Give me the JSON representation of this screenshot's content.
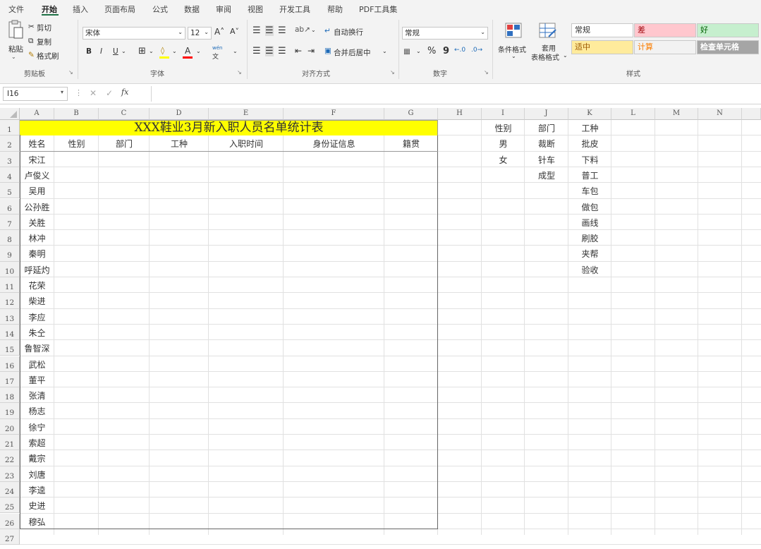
{
  "menu": {
    "tabs": [
      "文件",
      "开始",
      "插入",
      "页面布局",
      "公式",
      "数据",
      "审阅",
      "视图",
      "开发工具",
      "帮助",
      "PDF工具集"
    ],
    "active_tab": "开始"
  },
  "ribbon": {
    "clipboard": {
      "paste": "粘贴",
      "cut": "剪切",
      "copy": "复制",
      "format_painter": "格式刷",
      "label": "剪贴板"
    },
    "font": {
      "name": "宋体",
      "size": "12",
      "bold": "B",
      "italic": "I",
      "underline": "U",
      "label": "字体",
      "phonetic": "wén"
    },
    "alignment": {
      "wrap": "自动换行",
      "merge": "合并后居中",
      "label": "对齐方式"
    },
    "number": {
      "format": "常规",
      "percent": "%",
      "comma": "9",
      "label": "数字"
    },
    "styles": {
      "conditional": "条件格式",
      "table_format_1": "套用",
      "table_format_2": "表格格式",
      "cells": [
        {
          "label": "常规",
          "bg": "#ffffff",
          "fg": "#333333"
        },
        {
          "label": "差",
          "bg": "#ffc7ce",
          "fg": "#9c0006"
        },
        {
          "label": "好",
          "bg": "#c6efce",
          "fg": "#006100"
        },
        {
          "label": "适中",
          "bg": "#ffeb9c",
          "fg": "#9c5700"
        },
        {
          "label": "计算",
          "bg": "#f2f2f2",
          "fg": "#fa7d00"
        },
        {
          "label": "检查单元格",
          "bg": "#a5a5a5",
          "fg": "#ffffff"
        }
      ],
      "label": "样式"
    }
  },
  "formula_bar": {
    "name_box": "I16",
    "fx": "fx",
    "value": ""
  },
  "sheet": {
    "columns": [
      "A",
      "B",
      "C",
      "D",
      "E",
      "F",
      "G",
      "H",
      "I",
      "J",
      "K",
      "L",
      "M",
      "N"
    ],
    "rows": [
      "1",
      "2",
      "3",
      "4",
      "5",
      "6",
      "7",
      "8",
      "9",
      "10",
      "11",
      "12",
      "13",
      "14",
      "15",
      "16",
      "17",
      "18",
      "19",
      "20",
      "21",
      "22",
      "23",
      "24",
      "25",
      "26",
      "27"
    ],
    "title": "XXX鞋业3月新入职人员名单统计表",
    "headers": [
      "姓名",
      "性别",
      "部门",
      "工种",
      "入职时间",
      "身份证信息",
      "籍贯"
    ],
    "names": [
      "宋江",
      "卢俊义",
      "吴用",
      "公孙胜",
      "关胜",
      "林冲",
      "秦明",
      "呼延灼",
      "花荣",
      "柴进",
      "李应",
      "朱仝",
      "鲁智深",
      "武松",
      "董平",
      "张清",
      "杨志",
      "徐宁",
      "索超",
      "戴宗",
      "刘唐",
      "李逵",
      "史进",
      "穆弘"
    ],
    "lookup_headers": [
      "性别",
      "部门",
      "工种"
    ],
    "gender_list": [
      "男",
      "女"
    ],
    "dept_list": [
      "裁断",
      "针车",
      "成型"
    ],
    "job_list": [
      "批皮",
      "下料",
      "普工",
      "车包",
      "做包",
      "画线",
      "刷胶",
      "夹帮",
      "验收"
    ],
    "title_bg": "#ffff00"
  }
}
